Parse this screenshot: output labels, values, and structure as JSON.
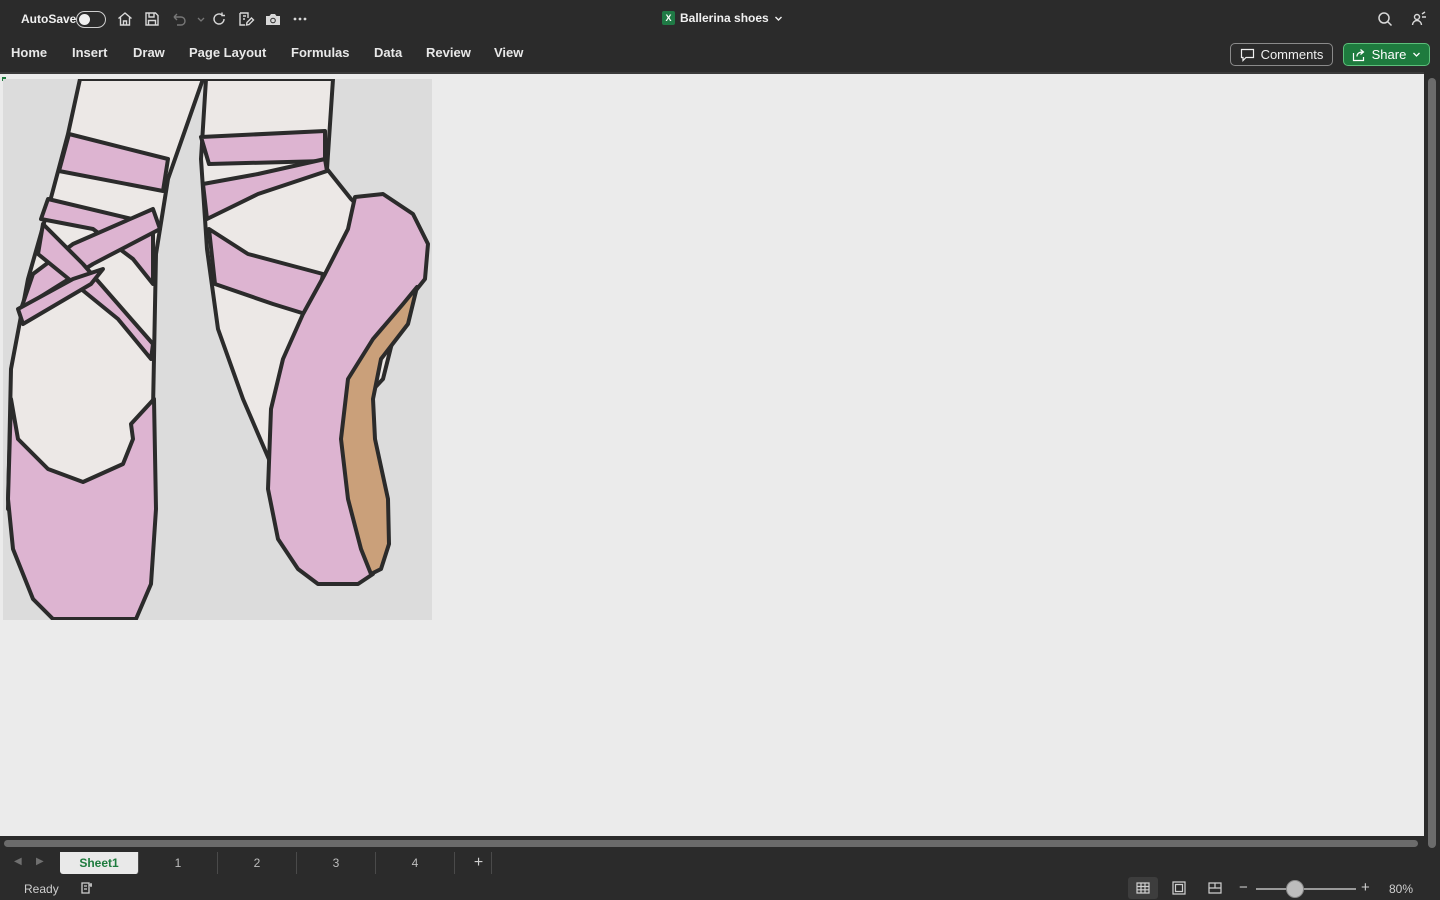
{
  "titlebar": {
    "autosave_label": "AutoSave",
    "autosave_on": false,
    "document_title": "Ballerina shoes",
    "app_badge": "X"
  },
  "ribbon": {
    "tabs": [
      {
        "label": "Home"
      },
      {
        "label": "Insert"
      },
      {
        "label": "Draw"
      },
      {
        "label": "Page Layout"
      },
      {
        "label": "Formulas"
      },
      {
        "label": "Data"
      },
      {
        "label": "Review"
      },
      {
        "label": "View"
      }
    ],
    "comments_label": "Comments",
    "share_label": "Share"
  },
  "artwork": {
    "colors": {
      "background": "#dcdcdc",
      "outline": "#2b2b2b",
      "tights": "#ece8e6",
      "shoe_pink": "#ddb4d1",
      "sole_tan": "#caa07a"
    }
  },
  "sheets": {
    "tabs": [
      {
        "label": "Sheet1",
        "active": true
      },
      {
        "label": "1",
        "active": false
      },
      {
        "label": "2",
        "active": false
      },
      {
        "label": "3",
        "active": false
      },
      {
        "label": "4",
        "active": false
      }
    ],
    "add_icon": "+"
  },
  "status": {
    "text": "Ready",
    "zoom_percent": 80,
    "zoom_label": "80%"
  },
  "icons": [
    "home-icon",
    "save-icon",
    "undo-icon",
    "refresh-icon",
    "edit-icon",
    "camera-icon",
    "more-icon",
    "search-icon",
    "share-people-icon",
    "comment-icon",
    "accessibility-icon",
    "normal-view-icon",
    "page-layout-icon",
    "page-break-icon"
  ],
  "colors": {
    "chrome": "#2b2b2b",
    "sheet_bg": "#ebebeb",
    "accent_green": "#1e7b3e"
  }
}
